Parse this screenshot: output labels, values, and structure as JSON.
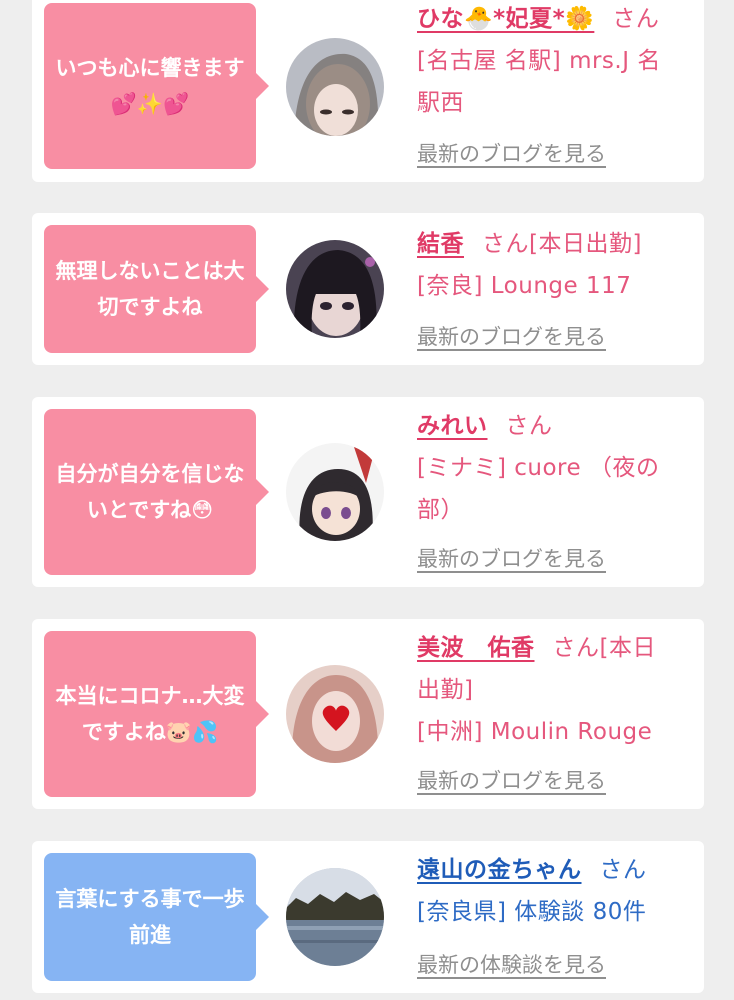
{
  "cards": [
    {
      "comment": "いつも心に響きます💕✨💕",
      "name": "ひな🐣*妃夏*🌼",
      "suffix": "さん",
      "shop_line1": "[名古屋 名駅] mrs.J 名",
      "shop_line2": "駅西",
      "link": "最新のブログを見る"
    },
    {
      "comment": "無理しないことは大切ですよね",
      "name": "結香",
      "suffix": "さん[本日出勤]",
      "shop_line1": "[奈良] Lounge 117",
      "link": "最新のブログを見る"
    },
    {
      "comment": "自分が自分を信じないとですね😳",
      "name": "みれい",
      "suffix": "さん",
      "shop_line1": "[ミナミ] cuore （夜の",
      "shop_line2": "部）",
      "link": "最新のブログを見る"
    },
    {
      "comment": "本当にコロナ…大変ですよね🐷💦",
      "name": "美波　佑香",
      "suffix": "さん[本日",
      "suffix_line2": "出勤]",
      "shop_line1": "[中洲] Moulin Rouge",
      "link": "最新のブログを見る"
    },
    {
      "comment": "言葉にする事で一歩前進",
      "name": "遠山の金ちゃん",
      "suffix": "さん",
      "shop_line1": "[奈良県] 体験談 80件",
      "link": "最新の体験談を見る"
    }
  ],
  "colors": {
    "pink_bubble": "#f88ea3",
    "blue_bubble": "#86b4f3",
    "pink_text": "#e5577d",
    "blue_text": "#2e6bc5",
    "link_gray": "#8f8f8f"
  }
}
